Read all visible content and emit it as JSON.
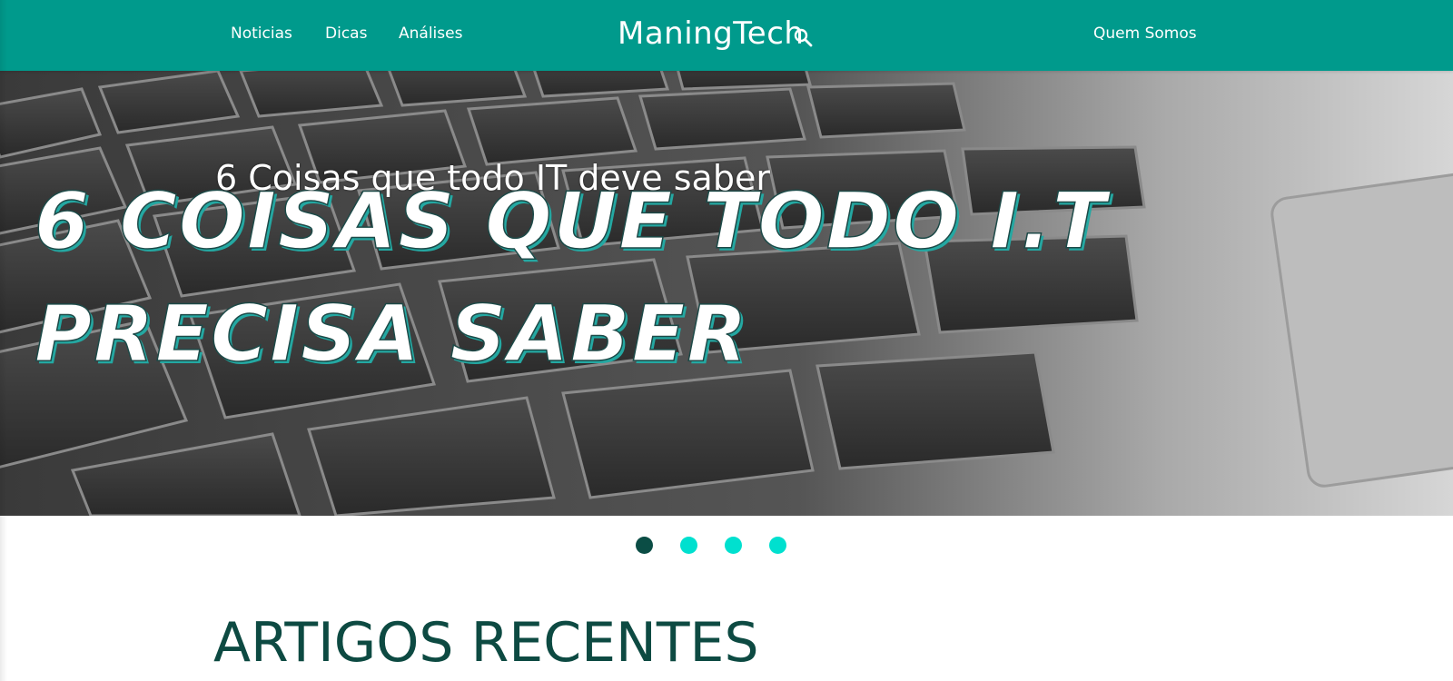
{
  "nav": {
    "brand": "ManingTech",
    "links": [
      "Noticias",
      "Dicas",
      "Análises"
    ],
    "right_link": "Quem Somos",
    "search_icon": "search-icon",
    "background_color": "#009a8c"
  },
  "hero": {
    "caption": "6 Coisas que todo IT deve saber",
    "headline_line1": "6 COISAS QUE TODO I.T",
    "headline_line2": "PRECISA SABER"
  },
  "slider": {
    "total_slides": 4,
    "active_index": 0,
    "active_color": "#0b4d45",
    "inactive_color": "#00e0cf"
  },
  "recent": {
    "title": "ARTIGOS RECENTES"
  }
}
